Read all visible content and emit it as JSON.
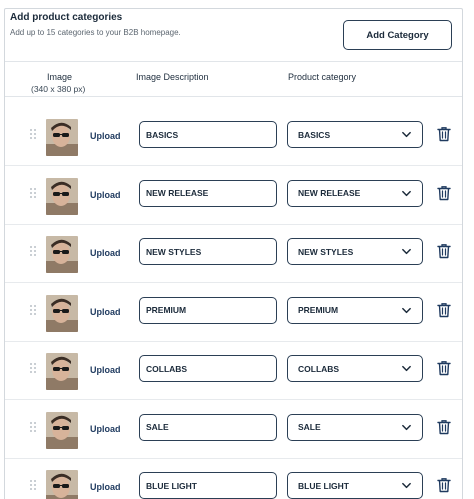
{
  "header": {
    "title": "Add product categories",
    "subtitle": "Add up to 15 categories to your B2B homepage.",
    "add_button_label": "Add Category"
  },
  "columns": {
    "image": "Image",
    "image_size": "(340 x 380 px)",
    "description": "Image Description",
    "category": "Product category"
  },
  "icons": {
    "drag": "drag-handle-icon",
    "chevron": "chevron-down-icon",
    "delete": "trash-icon"
  },
  "rows": [
    {
      "upload_label": "Upload",
      "description": "BASICS",
      "category": "BASICS"
    },
    {
      "upload_label": "Upload",
      "description": "NEW RELEASE",
      "category": "NEW RELEASE"
    },
    {
      "upload_label": "Upload",
      "description": "NEW STYLES",
      "category": "NEW STYLES"
    },
    {
      "upload_label": "Upload",
      "description": "PREMIUM",
      "category": "PREMIUM"
    },
    {
      "upload_label": "Upload",
      "description": "COLLABS",
      "category": "COLLABS"
    },
    {
      "upload_label": "Upload",
      "description": "SALE",
      "category": "SALE"
    },
    {
      "upload_label": "Upload",
      "description": "BLUE LIGHT",
      "category": "BLUE LIGHT"
    }
  ]
}
